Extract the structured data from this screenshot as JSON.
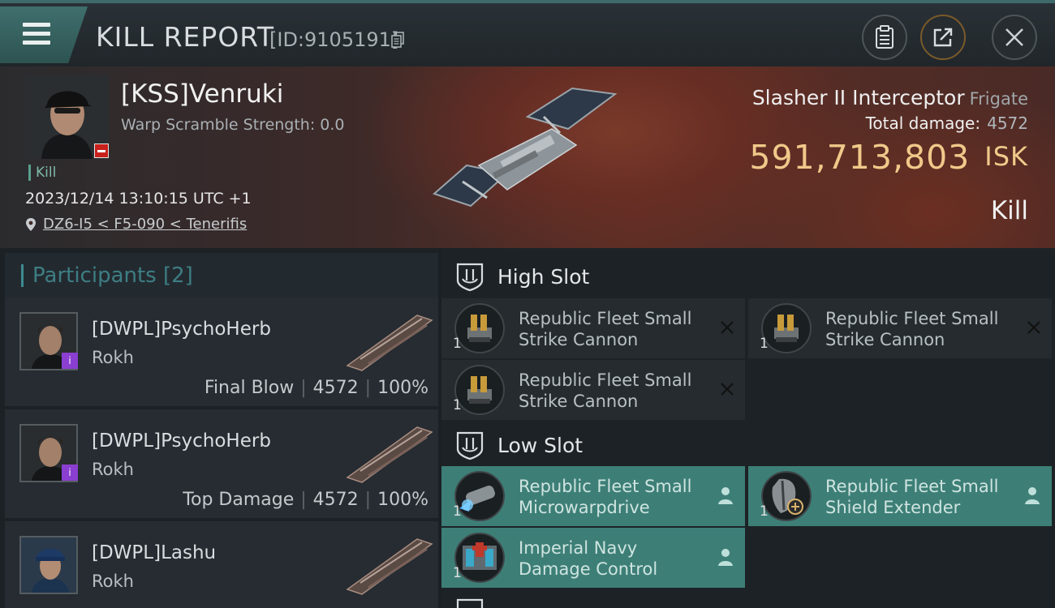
{
  "header": {
    "title": "KILL REPORT",
    "report_id": "[ID:9105191]",
    "icons": [
      "menu-icon",
      "copy-icon",
      "clipboard-icon",
      "share-icon",
      "close-icon"
    ]
  },
  "victim": {
    "name": "[KSS]Venruki",
    "scramble": "Warp Scramble Strength: 0.0",
    "kill_tag": "Kill",
    "datetime": "2023/12/14 13:10:15 UTC +1",
    "location": "DZ6-I5 < F5-090 < Tenerifis"
  },
  "ship": {
    "name": "Slasher II Interceptor",
    "class": "Frigate",
    "total_damage_label": "Total damage:",
    "total_damage": "4572",
    "isk_value": "591,713,803",
    "isk_unit": "ISK",
    "result": "Kill"
  },
  "participants": {
    "label": "Participants",
    "count": "[2]",
    "items": [
      {
        "name": "[DWPL]PsychoHerb",
        "ship": "Rokh",
        "role": "Final Blow",
        "damage": "4572",
        "percent": "100%"
      },
      {
        "name": "[DWPL]PsychoHerb",
        "ship": "Rokh",
        "role": "Top Damage",
        "damage": "4572",
        "percent": "100%"
      },
      {
        "name": "[DWPL]Lashu",
        "ship": "Rokh"
      }
    ]
  },
  "slots": {
    "high": {
      "label": "High Slot",
      "modules": [
        {
          "qty": "1",
          "line1": "Republic Fleet Small",
          "line2": "Strike Cannon",
          "status": "destroyed"
        },
        {
          "qty": "1",
          "line1": "Republic Fleet Small",
          "line2": "Strike Cannon",
          "status": "destroyed"
        },
        {
          "qty": "1",
          "line1": "Republic Fleet Small",
          "line2": "Strike Cannon",
          "status": "destroyed"
        }
      ]
    },
    "low": {
      "label": "Low Slot",
      "modules": [
        {
          "qty": "1",
          "line1": "Republic Fleet Small",
          "line2": "Microwarpdrive",
          "status": "dropped"
        },
        {
          "qty": "1",
          "line1": "Republic Fleet Small",
          "line2": "Shield Extender",
          "status": "dropped"
        },
        {
          "qty": "1",
          "line1": "Imperial Navy",
          "line2": "Damage Control",
          "status": "dropped"
        }
      ]
    }
  },
  "colors": {
    "accent": "#3d7f77",
    "isk": "#f0c98a",
    "header_bg": "#252b30"
  }
}
